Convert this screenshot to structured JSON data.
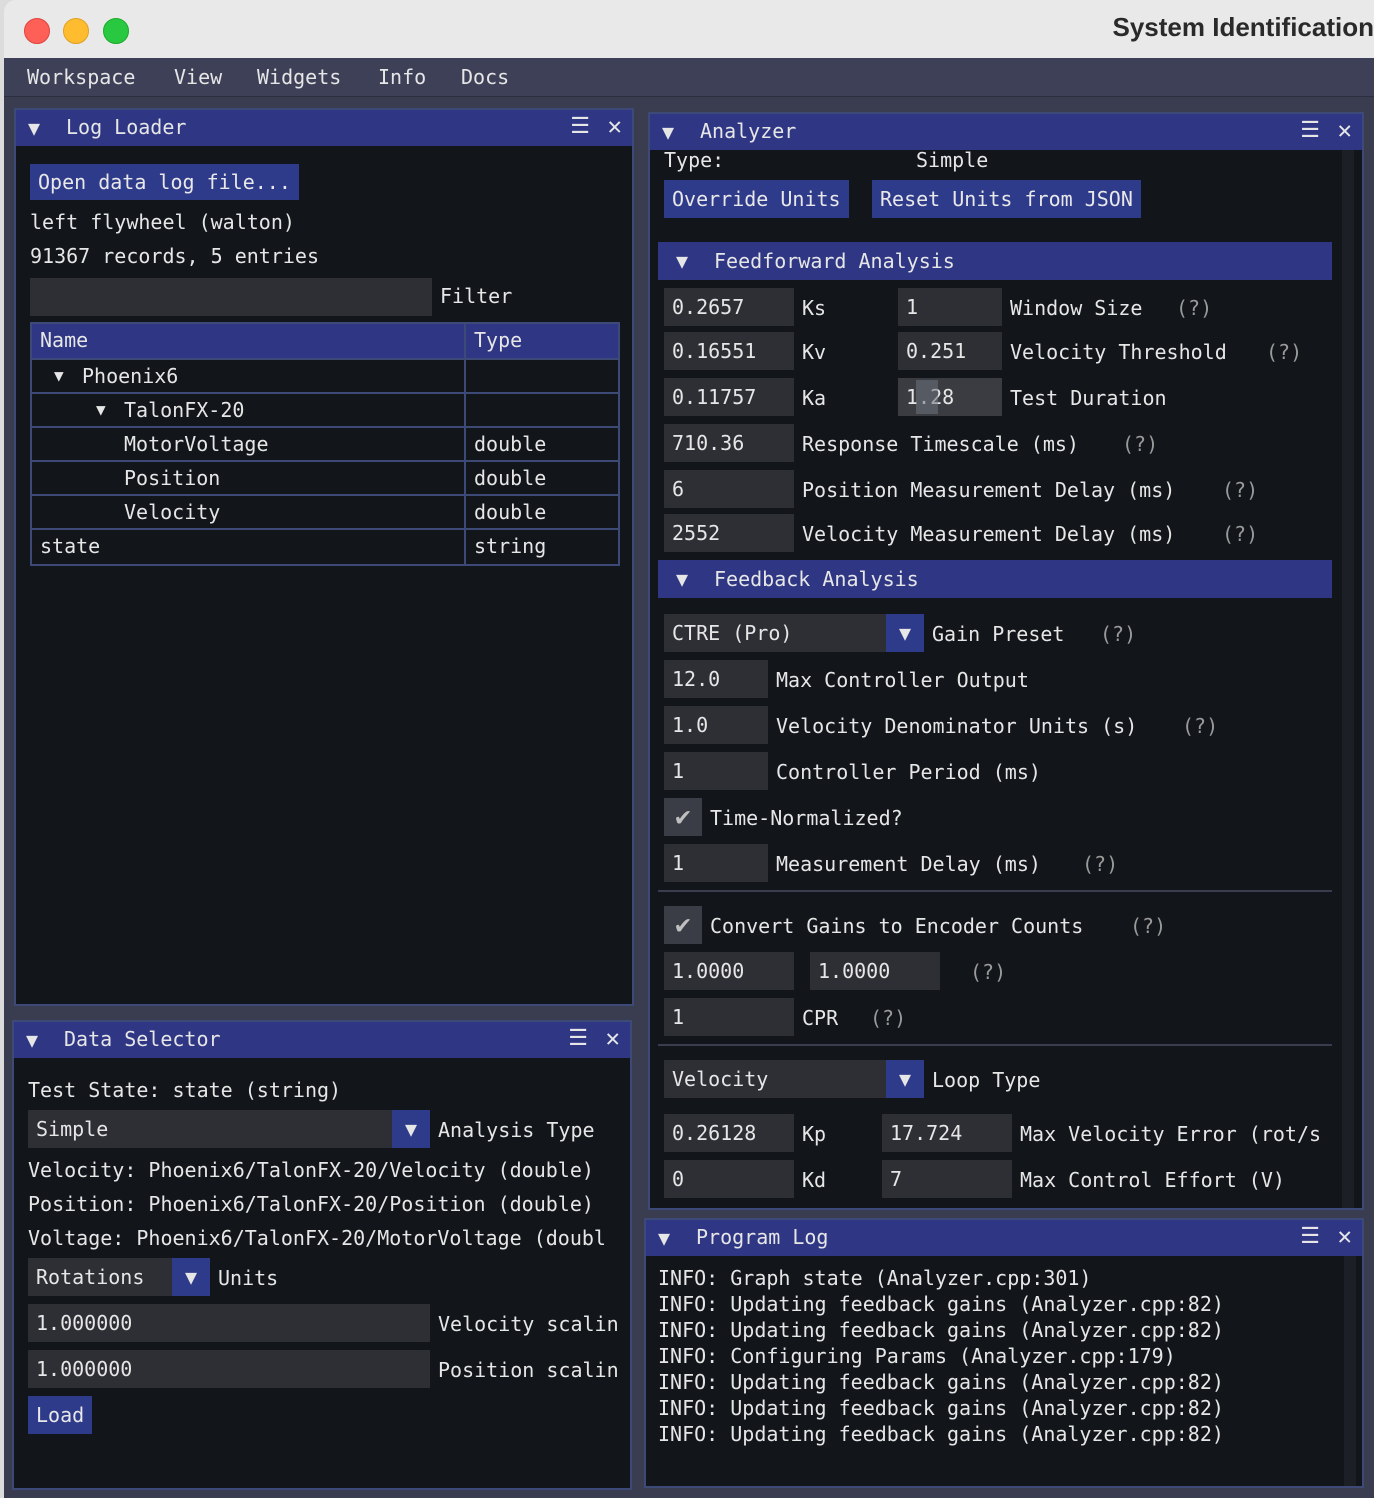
{
  "window": {
    "title": "System Identification"
  },
  "menu": [
    "Workspace",
    "View",
    "Widgets",
    "Info",
    "Docs"
  ],
  "log_loader": {
    "title": "Log Loader",
    "open_button": "Open data log file...",
    "file_name": "left flywheel (walton)",
    "summary": "91367 records, 5 entries",
    "filter_value": "",
    "filter_label": "Filter",
    "columns": [
      "Name",
      "Type"
    ],
    "rows": [
      {
        "name": "Phoenix6",
        "type": "",
        "expander": "▼"
      },
      {
        "name": "TalonFX-20",
        "type": "",
        "expander": "▼"
      },
      {
        "name": "MotorVoltage",
        "type": "double",
        "expander": ""
      },
      {
        "name": "Position",
        "type": "double",
        "expander": ""
      },
      {
        "name": "Velocity",
        "type": "double",
        "expander": ""
      },
      {
        "name": "state",
        "type": "string",
        "expander": ""
      }
    ]
  },
  "data_selector": {
    "title": "Data Selector",
    "test_state": "Test State: state (string)",
    "analysis_type_value": "Simple",
    "analysis_type_label": "Analysis Type",
    "velocity_line": "Velocity: Phoenix6/TalonFX-20/Velocity (double)",
    "position_line": "Position: Phoenix6/TalonFX-20/Position (double)",
    "voltage_line": "Voltage: Phoenix6/TalonFX-20/MotorVoltage (doubl",
    "units_value": "Rotations",
    "units_label": "Units",
    "velocity_scaling_value": "1.000000",
    "velocity_scaling_label": "Velocity scalin",
    "position_scaling_value": "1.000000",
    "position_scaling_label": "Position scalin",
    "load_button": "Load"
  },
  "analyzer": {
    "title": "Analyzer",
    "type_label": "Type:",
    "type_value": "Simple",
    "override_units": "Override Units",
    "reset_units": "Reset Units from JSON",
    "help": "(?)",
    "feedforward": {
      "header": "Feedforward Analysis",
      "ks_value": "0.2657",
      "ks_label": "Ks",
      "kv_value": "0.16551",
      "kv_label": "Kv",
      "ka_value": "0.11757",
      "ka_label": "Ka",
      "window_size_value": "1",
      "window_size_label": "Window Size",
      "velocity_threshold_value": "0.251",
      "velocity_threshold_label": "Velocity Threshold",
      "test_duration_value": "1.28",
      "test_duration_label": "Test Duration",
      "response_timescale_value": "710.36",
      "response_timescale_label": "Response Timescale (ms)",
      "position_delay_value": "6",
      "position_delay_label": "Position Measurement Delay (ms)",
      "velocity_delay_value": "2552",
      "velocity_delay_label": "Velocity Measurement Delay (ms)"
    },
    "feedback": {
      "header": "Feedback Analysis",
      "gain_preset_value": "CTRE (Pro)",
      "gain_preset_label": "Gain Preset",
      "max_output_value": "12.0",
      "max_output_label": "Max Controller Output",
      "vel_denom_value": "1.0",
      "vel_denom_label": "Velocity Denominator Units (s)",
      "controller_period_value": "1",
      "controller_period_label": "Controller Period (ms)",
      "time_normalized_label": "Time-Normalized?",
      "measurement_delay_value": "1",
      "measurement_delay_label": "Measurement Delay (ms)",
      "convert_gains_label": "Convert Gains to Encoder Counts",
      "gearing_a": "1.0000",
      "gearing_b": "1.0000",
      "cpr_value": "1",
      "cpr_label": "CPR",
      "loop_type_value": "Velocity",
      "loop_type_label": "Loop Type",
      "kp_value": "0.26128",
      "kp_label": "Kp",
      "kd_value": "0",
      "kd_label": "Kd",
      "max_vel_error_value": "17.724",
      "max_vel_error_label": "Max Velocity Error (rot/s",
      "max_effort_value": "7",
      "max_effort_label": "Max Control Effort (V)"
    }
  },
  "program_log": {
    "title": "Program Log",
    "lines": [
      "INFO: Graph state (Analyzer.cpp:301)",
      "INFO: Updating feedback gains (Analyzer.cpp:82)",
      "INFO: Updating feedback gains (Analyzer.cpp:82)",
      "INFO: Configuring Params (Analyzer.cpp:179)",
      "INFO: Updating feedback gains (Analyzer.cpp:82)",
      "INFO: Updating feedback gains (Analyzer.cpp:82)",
      "INFO: Updating feedback gains (Analyzer.cpp:82)"
    ]
  },
  "icons": {
    "collapse": "▼",
    "menu": "☰",
    "close": "✕",
    "check": "✔"
  }
}
